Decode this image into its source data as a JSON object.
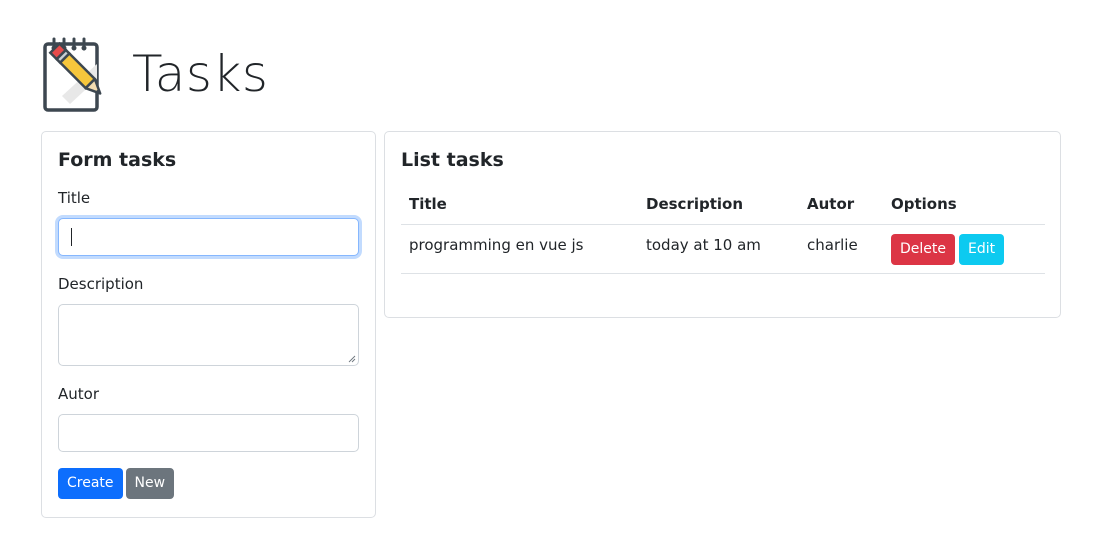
{
  "header": {
    "title": "Tasks",
    "logo_icon": "notepad-pencil-icon"
  },
  "form": {
    "title": "Form tasks",
    "fields": {
      "title_label": "Title",
      "title_value": "",
      "description_label": "Description",
      "description_value": "",
      "autor_label": "Autor",
      "autor_value": ""
    },
    "buttons": {
      "create": "Create",
      "new": "New"
    }
  },
  "list": {
    "title": "List tasks",
    "columns": [
      "Title",
      "Description",
      "Autor",
      "Options"
    ],
    "rows": [
      {
        "title": "programming en vue js",
        "description": "today at 10 am",
        "autor": "charlie",
        "delete_label": "Delete",
        "edit_label": "Edit"
      }
    ]
  },
  "colors": {
    "primary": "#0d6efd",
    "secondary": "#6c757d",
    "danger": "#dc3545",
    "info": "#0dcaf0",
    "focus_ring": "#86b7fe"
  }
}
